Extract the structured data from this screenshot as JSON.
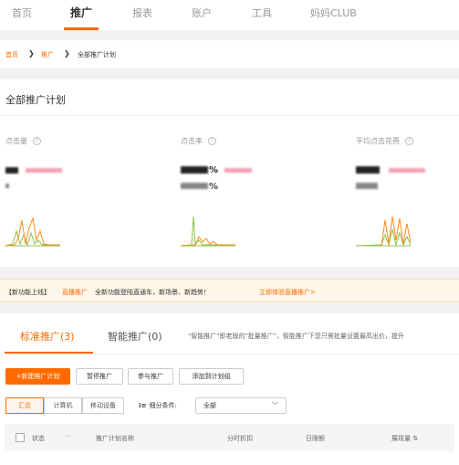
{
  "topnav": {
    "tabs": [
      {
        "label": "首页"
      },
      {
        "label": "推广"
      },
      {
        "label": "报表"
      },
      {
        "label": "账户"
      },
      {
        "label": "工具"
      },
      {
        "label": "妈妈CLUB"
      }
    ],
    "active_index": 1
  },
  "breadcrumb": {
    "home": "首页",
    "promo": "推广",
    "current": "全部推广计划",
    "separator": "❯"
  },
  "overview": {
    "title": "全部推广计划",
    "help_glyph": "?",
    "metrics": [
      {
        "label": "点击量",
        "unit": "",
        "spark_color": "#ff8c1a"
      },
      {
        "label": "点击率",
        "unit": "%",
        "spark_color": "#8bc34a"
      },
      {
        "label": "平均点击花费",
        "unit": "",
        "spark_color": "#ff8c1a"
      }
    ],
    "unit_second_row": "%"
  },
  "notice": {
    "tag": "【新功能上线】",
    "highlight": "直播推广",
    "text": "全新功能登陆直通车，新场景、新趋势！",
    "link": "立即体验直播推广>"
  },
  "campaign_panel": {
    "tabs": [
      {
        "label": "标准推广(3)"
      },
      {
        "label": "智能推广(0)"
      }
    ],
    "description": "\"智能推广\"即老版的\"批量推广\"，智能推广下您只需批量设置最高出价，提升",
    "toolbar": {
      "new_plan": "+新建推广计划",
      "pause": "暂停推广",
      "join": "参与推广",
      "add_group": "添加到计划组"
    },
    "device_tabs": [
      "汇总",
      "计算机",
      "移动设备"
    ],
    "filter_label": "细分条件:",
    "filter_icon": "list-sort-icon",
    "filter_value": "全部",
    "table_headers": {
      "status": "状态",
      "name": "推广计划名称",
      "discount": "分时折扣",
      "budget": "日限额",
      "impressions": "展现量 ⇅"
    }
  },
  "colors": {
    "accent": "#ff6a00",
    "notice_bg": "#fef6e7"
  }
}
